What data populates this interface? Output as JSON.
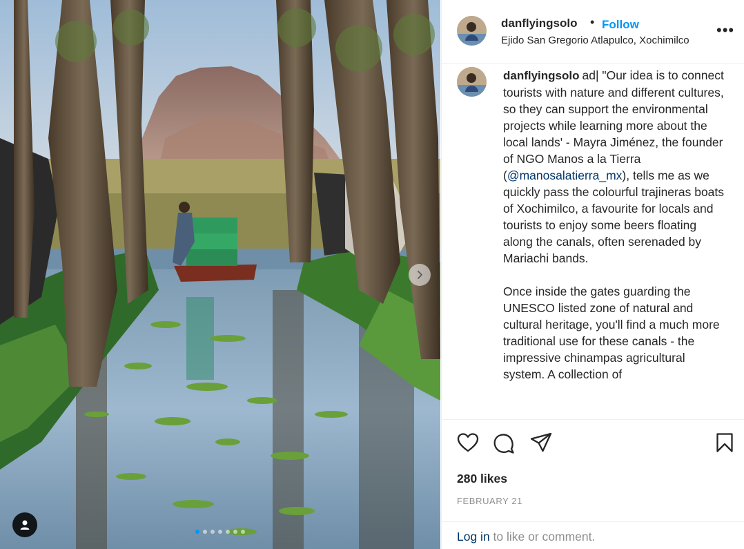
{
  "post": {
    "username": "danflyingsolo",
    "follow_label": "Follow",
    "location": "Ejido San Gregorio Atlapulco, Xochimilco",
    "more_label": "•••",
    "image_count": 7,
    "active_image_index": 0
  },
  "caption": {
    "username": "danflyingsolo",
    "text_part1": "ad| \"Our idea is to connect tourists with nature and different cultures, so they can support the environmental projects while learning more about the local lands' - Mayra Jiménez, the founder of NGO Manos a la Tierra (",
    "mention": "@manosalatierra_mx",
    "text_part2": "), tells me as we quickly pass the colourful trajineras boats of Xochimilco, a favourite for locals and tourists to enjoy some beers floating along the canals, often serenaded by Mariachi bands.",
    "paragraph2": "Once inside the gates guarding the UNESCO listed zone of natural and cultural heritage, you'll find a much more traditional use for these canals - the impressive chinampas agricultural system. A collection of"
  },
  "stats": {
    "likes": "280 likes",
    "date": "FEBRUARY 21"
  },
  "login": {
    "link_label": "Log in",
    "rest": " to like or comment."
  },
  "icons": {
    "like": "heart-icon",
    "comment": "comment-icon",
    "share": "share-icon",
    "save": "bookmark-icon",
    "next": "chevron-right-icon",
    "tags": "user-tag-icon"
  },
  "colors": {
    "accent": "#0095f6",
    "mention": "#00376b",
    "muted": "#8e8e8e",
    "text": "#262626"
  }
}
